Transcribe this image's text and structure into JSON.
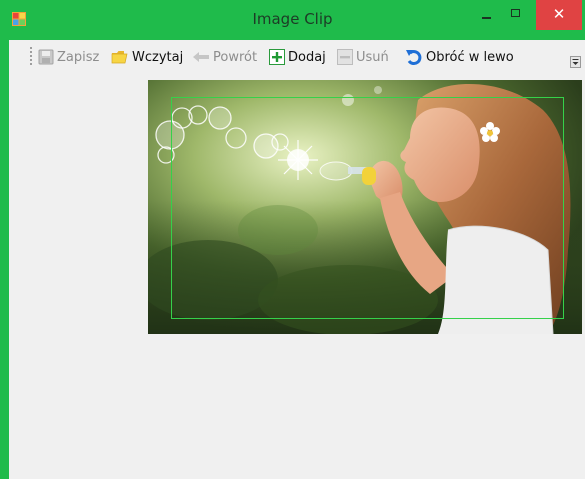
{
  "window": {
    "title": "Image Clip",
    "close_glyph": "✕",
    "accent_color": "#1fbb4b",
    "close_color": "#e04343"
  },
  "toolbar": {
    "items": [
      {
        "label": "Zapisz",
        "icon": "save-icon",
        "enabled": false
      },
      {
        "label": "Wczytaj",
        "icon": "folder-open-icon",
        "enabled": true
      },
      {
        "label": "Powrót",
        "icon": "arrow-back-icon",
        "enabled": false
      },
      {
        "label": "Dodaj",
        "icon": "plus-icon",
        "enabled": true
      },
      {
        "label": "Usuń",
        "icon": "minus-icon",
        "enabled": false
      },
      {
        "label": "Obróć w lewo",
        "icon": "rotate-left-icon",
        "enabled": true
      }
    ]
  },
  "canvas": {
    "image_subject": "girl blowing soap bubbles",
    "clip_rect_color": "#35d14a"
  }
}
